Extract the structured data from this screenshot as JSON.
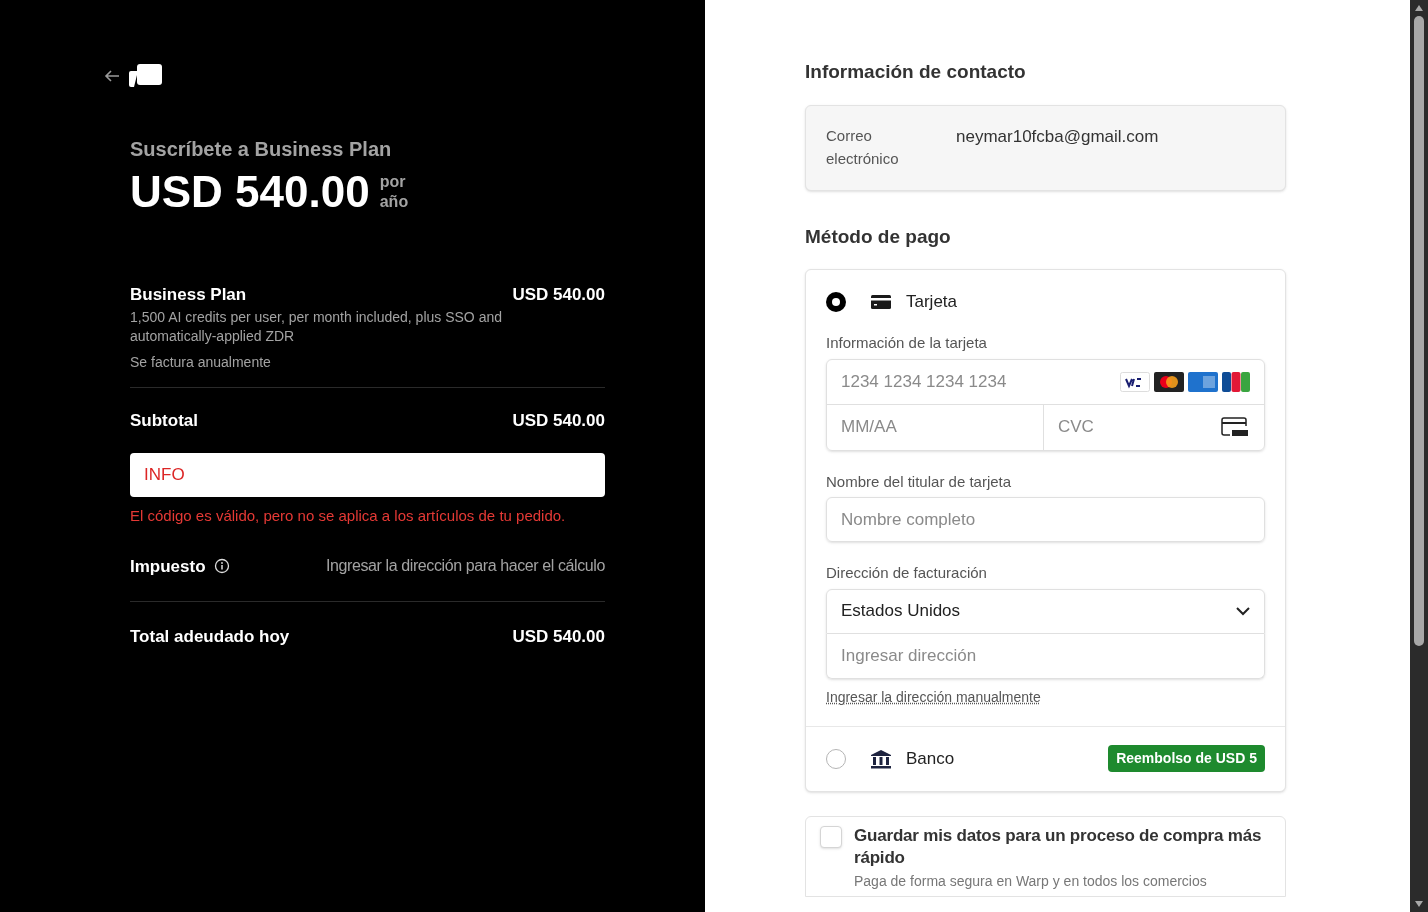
{
  "summary": {
    "subscribe_title": "Suscríbete a Business Plan",
    "price": "USD 540.00",
    "period": [
      "por",
      "año"
    ],
    "line_item": {
      "name": "Business Plan",
      "price": "USD 540.00",
      "description": "1,500 AI credits per user, per month included, plus SSO and automatically-applied ZDR",
      "billing": "Se factura anualmente"
    },
    "subtotal": {
      "label": "Subtotal",
      "value": "USD 540.00"
    },
    "promo": {
      "value": "INFO",
      "error": "El código es válido, pero no se aplica a los artículos de tu pedido."
    },
    "tax": {
      "label": "Impuesto",
      "value": "Ingresar la dirección para hacer el cálculo"
    },
    "total": {
      "label": "Total adeudado hoy",
      "value": "USD 540.00"
    }
  },
  "contact": {
    "heading": "Información de contacto",
    "email_label": "Correo electrónico",
    "email": "neymar10fcba@gmail.com"
  },
  "payment": {
    "heading": "Método de pago",
    "methods": [
      {
        "kind": "card",
        "label": "Tarjeta",
        "selected": true
      },
      {
        "kind": "bank",
        "label": "Banco",
        "selected": false,
        "badge": "Reembolso de USD 5"
      }
    ],
    "card_label": "Información de la tarjeta",
    "card_number_placeholder": "1234 1234 1234 1234",
    "expiry_placeholder": "MM/AA",
    "cvc_placeholder": "CVC",
    "holder_label": "Nombre del titular de tarjeta",
    "holder_placeholder": "Nombre completo",
    "billing_label": "Dirección de facturación",
    "country": "Estados Unidos",
    "address_placeholder": "Ingresar dirección",
    "manual_link": "Ingresar la dirección manualmente"
  },
  "save": {
    "checked": false,
    "title": "Guardar mis datos para un proceso de compra más rápido",
    "description": "Paga de forma segura en Warp y en todos los comercios"
  }
}
